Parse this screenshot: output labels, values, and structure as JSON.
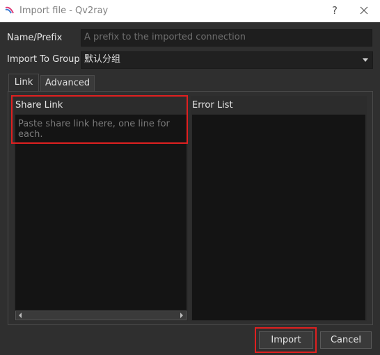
{
  "window": {
    "title": "Import file - Qv2ray",
    "help_label": "?"
  },
  "form": {
    "name_label": "Name/Prefix",
    "name_placeholder": "A prefix to the imported connection",
    "group_label": "Import To Group",
    "group_value": "默认分组"
  },
  "tabs": [
    {
      "label": "Link",
      "active": true
    },
    {
      "label": "Advanced",
      "active": false
    }
  ],
  "link_tab": {
    "share_link_title": "Share Link",
    "share_link_placeholder": "Paste share link here, one line for each.",
    "error_list_title": "Error List"
  },
  "buttons": {
    "import": "Import",
    "cancel": "Cancel"
  },
  "colors": {
    "window_bg": "#2f2f2f",
    "highlight": "#e02020",
    "textarea_bg": "#141414"
  }
}
